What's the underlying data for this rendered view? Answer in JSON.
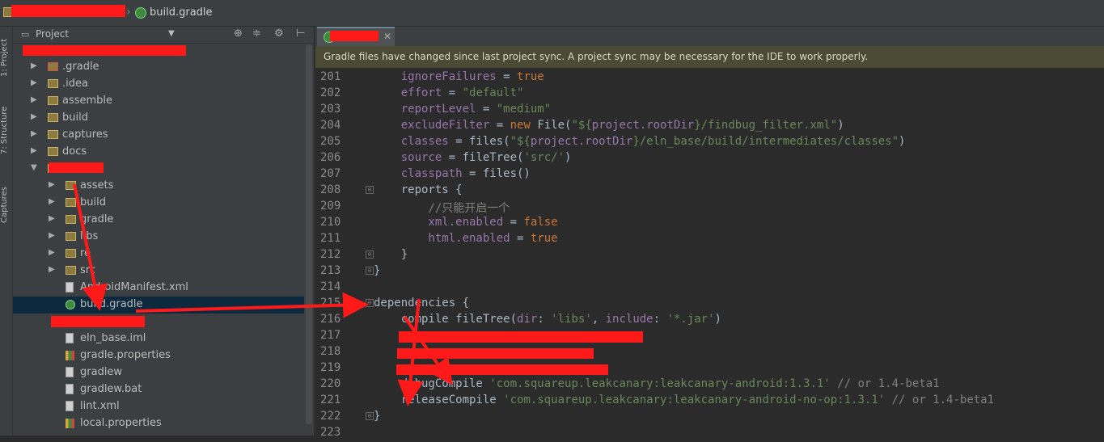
{
  "breadcrumb": {
    "file": "build.gradle"
  },
  "toolstrip": {
    "project": "1: Project",
    "structure": "7: Structure",
    "captures": "Captures"
  },
  "project_panel": {
    "title": "Project",
    "tree": [
      {
        "label": ".gradle",
        "icon": "folder-icon",
        "expand": "▶",
        "indent": 1,
        "red": true
      },
      {
        "label": ".idea",
        "icon": "folder-icon",
        "expand": "▶",
        "indent": 1
      },
      {
        "label": "assemble",
        "icon": "folder-icon",
        "expand": "▶",
        "indent": 1
      },
      {
        "label": "build",
        "icon": "folder-icon",
        "expand": "▶",
        "indent": 1
      },
      {
        "label": "captures",
        "icon": "folder-icon",
        "expand": "▶",
        "indent": 1
      },
      {
        "label": "docs",
        "icon": "folder-icon",
        "expand": "▶",
        "indent": 1
      },
      {
        "label": "",
        "icon": "folder-icon",
        "expand": "▼",
        "indent": 1
      },
      {
        "label": "assets",
        "icon": "folder-icon",
        "expand": "▶",
        "indent": 2
      },
      {
        "label": "build",
        "icon": "folder-icon",
        "expand": "▶",
        "indent": 2
      },
      {
        "label": "gradle",
        "icon": "folder-icon",
        "expand": "▶",
        "indent": 2
      },
      {
        "label": "libs",
        "icon": "folder-icon",
        "expand": "▶",
        "indent": 2
      },
      {
        "label": "re",
        "icon": "folder-icon",
        "expand": "▶",
        "indent": 2
      },
      {
        "label": "src",
        "icon": "folder-icon",
        "expand": "▶",
        "indent": 2
      },
      {
        "label": "AndroidManifest.xml",
        "icon": "xml-file-icon",
        "expand": "",
        "indent": 2
      },
      {
        "label": "build.gradle",
        "icon": "gradle-file-icon",
        "expand": "",
        "indent": 2,
        "selected": true
      },
      {
        "label": "",
        "icon": "",
        "expand": "",
        "indent": 2
      },
      {
        "label": "eln_base.iml",
        "icon": "iml-file-icon",
        "expand": "",
        "indent": 2
      },
      {
        "label": "gradle.properties",
        "icon": "properties-file-icon",
        "expand": "",
        "indent": 2
      },
      {
        "label": "gradlew",
        "icon": "text-file-icon",
        "expand": "",
        "indent": 2
      },
      {
        "label": "gradlew.bat",
        "icon": "text-file-icon",
        "expand": "",
        "indent": 2
      },
      {
        "label": "lint.xml",
        "icon": "xml-file-icon",
        "expand": "",
        "indent": 2
      },
      {
        "label": "local.properties",
        "icon": "properties-file-icon",
        "expand": "",
        "indent": 2
      }
    ]
  },
  "notice": "Gradle files have changed since last project sync. A project sync may be necessary for the IDE to work properly.",
  "code_lines": [
    {
      "n": "201",
      "fold": "",
      "segs": [
        [
          "id",
          "    ignoreFailures"
        ],
        [
          "fn",
          " = "
        ],
        [
          "kw",
          "true"
        ]
      ]
    },
    {
      "n": "202",
      "fold": "",
      "segs": [
        [
          "id",
          "    effort"
        ],
        [
          "fn",
          " = "
        ],
        [
          "str",
          "\"default\""
        ]
      ]
    },
    {
      "n": "203",
      "fold": "",
      "segs": [
        [
          "id",
          "    reportLevel"
        ],
        [
          "fn",
          " = "
        ],
        [
          "str",
          "\"medium\""
        ]
      ]
    },
    {
      "n": "204",
      "fold": "",
      "segs": [
        [
          "id",
          "    excludeFilter"
        ],
        [
          "fn",
          " = "
        ],
        [
          "kw",
          "new "
        ],
        [
          "fn",
          "File("
        ],
        [
          "str",
          "\"${"
        ],
        [
          "id",
          "project.rootDir"
        ],
        [
          "str",
          "}/findbug_filter.xml\""
        ],
        [
          "fn",
          ")"
        ]
      ]
    },
    {
      "n": "205",
      "fold": "",
      "segs": [
        [
          "id",
          "    classes"
        ],
        [
          "fn",
          " = files("
        ],
        [
          "str",
          "\"${"
        ],
        [
          "id",
          "project.rootDir"
        ],
        [
          "str",
          "}/eln_base/build/intermediates/classes\""
        ],
        [
          "fn",
          ")"
        ]
      ]
    },
    {
      "n": "206",
      "fold": "",
      "segs": [
        [
          "id",
          "    source"
        ],
        [
          "fn",
          " = fileTree("
        ],
        [
          "str",
          "'src/'"
        ],
        [
          "fn",
          ")"
        ]
      ]
    },
    {
      "n": "207",
      "fold": "",
      "segs": [
        [
          "id",
          "    classpath"
        ],
        [
          "fn",
          " = files()"
        ]
      ]
    },
    {
      "n": "208",
      "fold": "⊖",
      "segs": [
        [
          "fn",
          "    reports {"
        ]
      ]
    },
    {
      "n": "209",
      "fold": "",
      "segs": [
        [
          "cmt",
          "        //只能开启一个"
        ]
      ]
    },
    {
      "n": "210",
      "fold": "",
      "segs": [
        [
          "id",
          "        xml.enabled"
        ],
        [
          "fn",
          " = "
        ],
        [
          "kw",
          "false"
        ]
      ]
    },
    {
      "n": "211",
      "fold": "",
      "segs": [
        [
          "id",
          "        html.enabled"
        ],
        [
          "fn",
          " = "
        ],
        [
          "kw",
          "true"
        ]
      ]
    },
    {
      "n": "212",
      "fold": "⊖",
      "segs": [
        [
          "fn",
          "    }"
        ]
      ]
    },
    {
      "n": "213",
      "fold": "⊖",
      "segs": [
        [
          "fn",
          "}"
        ]
      ]
    },
    {
      "n": "214",
      "fold": "",
      "segs": [
        [
          "fn",
          ""
        ]
      ]
    },
    {
      "n": "215",
      "fold": "⊖",
      "segs": [
        [
          "fn",
          "dependencies {"
        ]
      ]
    },
    {
      "n": "216",
      "fold": "",
      "segs": [
        [
          "fn",
          "    compile fileTree("
        ],
        [
          "id",
          "dir"
        ],
        [
          "fn",
          ": "
        ],
        [
          "str",
          "'libs'"
        ],
        [
          "fn",
          ", "
        ],
        [
          "id",
          "include"
        ],
        [
          "fn",
          ": "
        ],
        [
          "str",
          "'*.jar'"
        ],
        [
          "fn",
          ")"
        ]
      ]
    },
    {
      "n": "217",
      "fold": "",
      "segs": [
        [
          "fn",
          ""
        ]
      ]
    },
    {
      "n": "218",
      "fold": "",
      "segs": [
        [
          "fn",
          ""
        ]
      ]
    },
    {
      "n": "219",
      "fold": "",
      "segs": [
        [
          "fn",
          ""
        ]
      ]
    },
    {
      "n": "220",
      "fold": "",
      "segs": [
        [
          "fn",
          "    debugCompile "
        ],
        [
          "str",
          "'com.squareup.leakcanary:leakcanary-android:1.3.1'"
        ],
        [
          "cmt",
          " // or 1.4-beta1"
        ]
      ]
    },
    {
      "n": "221",
      "fold": "",
      "segs": [
        [
          "fn",
          "    releaseCompile "
        ],
        [
          "str",
          "'com.squareup.leakcanary:leakcanary-android-no-op:1.3.1'"
        ],
        [
          "cmt",
          " // or 1.4-beta1"
        ]
      ]
    },
    {
      "n": "222",
      "fold": "⊖",
      "segs": [
        [
          "fn",
          "}"
        ]
      ]
    },
    {
      "n": "223",
      "fold": "",
      "segs": [
        [
          "fn",
          ""
        ]
      ]
    }
  ],
  "colors": {
    "annotation": "#ff1a1a",
    "selection": "#0d293e",
    "notice_bg": "#4b4a34"
  }
}
